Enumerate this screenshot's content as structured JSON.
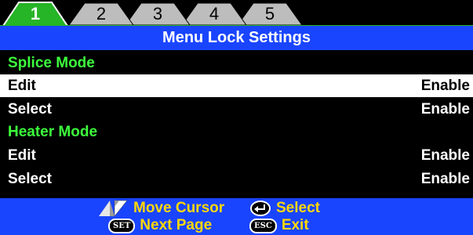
{
  "tabs": [
    {
      "label": "1",
      "active": true
    },
    {
      "label": "2",
      "active": false
    },
    {
      "label": "3",
      "active": false
    },
    {
      "label": "4",
      "active": false
    },
    {
      "label": "5",
      "active": false
    }
  ],
  "title": "Menu Lock Settings",
  "sections": [
    {
      "header": "Splice Mode",
      "items": [
        {
          "label": "Edit",
          "value": "Enable",
          "selected": true
        },
        {
          "label": "Select",
          "value": "Enable",
          "selected": false
        }
      ]
    },
    {
      "header": "Heater Mode",
      "items": [
        {
          "label": "Edit",
          "value": "Enable",
          "selected": false
        },
        {
          "label": "Select",
          "value": "Enable",
          "selected": false
        }
      ]
    }
  ],
  "footer": {
    "move_cursor": "Move Cursor",
    "select": "Select",
    "next_page": "Next Page",
    "exit": "Exit",
    "set_key": "SET",
    "esc_key": "ESC"
  },
  "colors": {
    "title_bar": "#1a45ff",
    "section_header": "#3cff3c",
    "footer_text": "#ffd800",
    "tab_inactive": "#bdbdbd",
    "tab_active": "#26b526"
  }
}
